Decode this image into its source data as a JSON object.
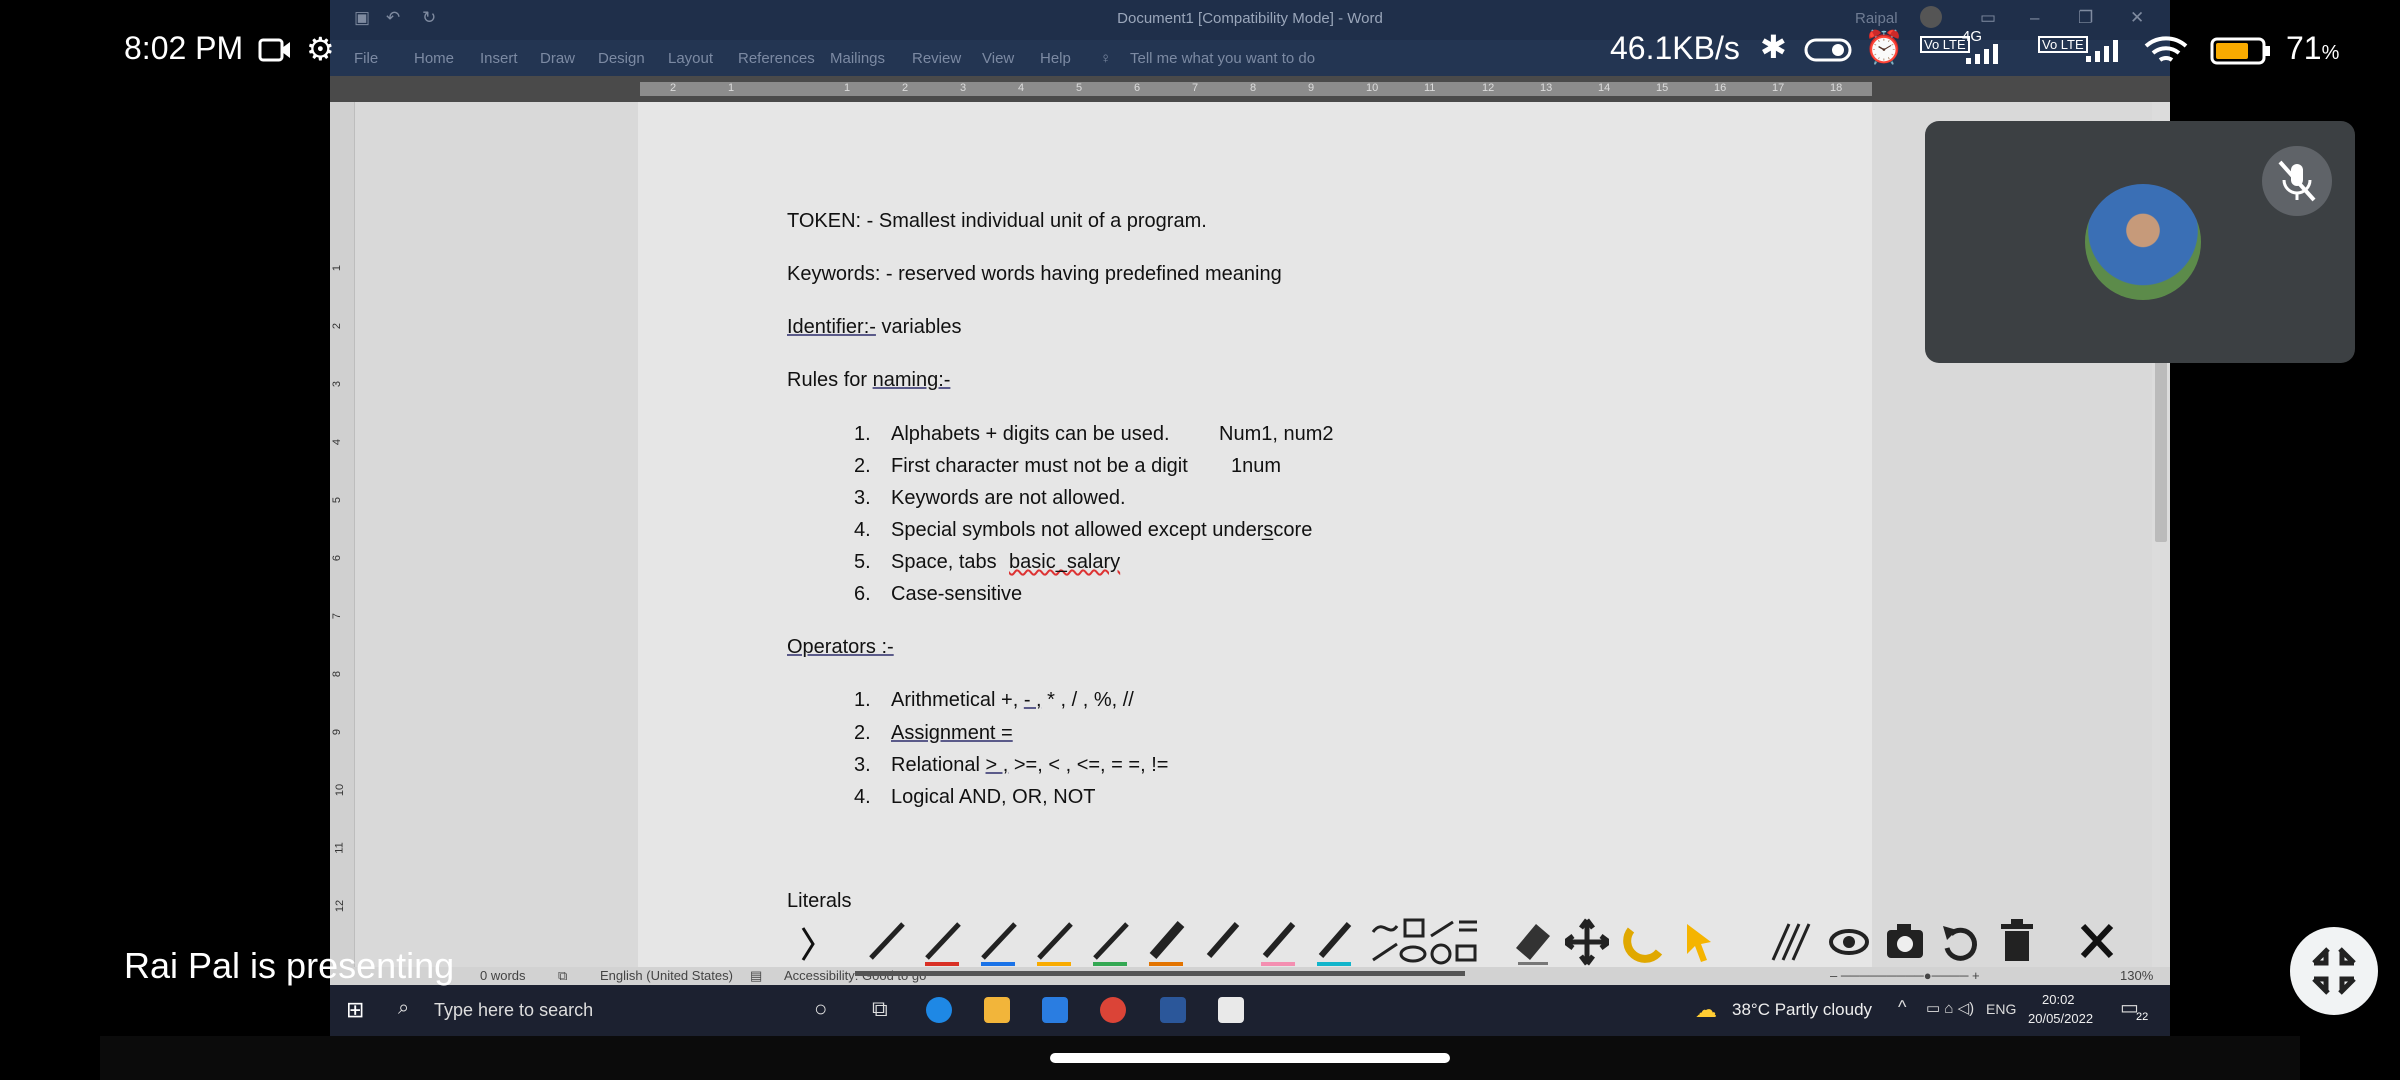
{
  "android_status": {
    "time": "8:02 PM",
    "net_speed": "46.1KB/s",
    "battery_percent": "71",
    "battery_unit": "%",
    "net_gen": "4G",
    "volte": "Vo LTE"
  },
  "word": {
    "window_title": "Document1 [Compatibility Mode] - Word",
    "user_name": "Raipal",
    "ribbon_tabs": [
      "File",
      "Home",
      "Insert",
      "Draw",
      "Design",
      "Layout",
      "References",
      "Mailings",
      "Review",
      "View",
      "Help"
    ],
    "tell_me": "Tell me what you want to do",
    "ruler_numbers": [
      "2",
      "1",
      "1",
      "2",
      "3",
      "4",
      "5",
      "6",
      "7",
      "8",
      "9",
      "10",
      "11",
      "12",
      "13",
      "14",
      "15",
      "16",
      "17",
      "18"
    ],
    "vruler_numbers": [
      "1",
      "2",
      "3",
      "4",
      "5",
      "6",
      "7",
      "8",
      "9",
      "10",
      "11",
      "12"
    ],
    "document": {
      "line_token": "TOKEN: - Smallest individual unit of a program.",
      "line_keywords": "Keywords: - reserved words having predefined meaning",
      "identifier_label": "Identifier:-",
      "identifier_rest": " variables",
      "rules_prefix": "Rules for ",
      "rules_underlined": "naming:-",
      "rules": [
        {
          "num": "1.",
          "text": "Alphabets + digits can be used.",
          "example": "Num1, num2"
        },
        {
          "num": "2.",
          "text": "First character must not be a digit",
          "example": "1num"
        },
        {
          "num": "3.",
          "text": "Keywords are not allowed.",
          "example": ""
        },
        {
          "num": "4.",
          "text": "Special symbols not allowed except underscore",
          "example": "_"
        },
        {
          "num": "5.",
          "text": "Space, tabs",
          "example": "basic_salary"
        },
        {
          "num": "6.",
          "text": "Case-sensitive",
          "example": ""
        }
      ],
      "operators_heading": "Operators :-",
      "operators": [
        {
          "num": "1.",
          "pre": "Arithmetical +, ",
          "ul": "- ,",
          "post": " * , / , %, //"
        },
        {
          "num": "2.",
          "pre": "",
          "ul": "Assignment  =",
          "post": ""
        },
        {
          "num": "3.",
          "pre": "Relational ",
          "ul": "> ,",
          "post": " >=, < , <=, = =, !="
        },
        {
          "num": "4.",
          "pre": "Logical AND, OR, NOT",
          "ul": "",
          "post": ""
        }
      ],
      "literals": "Literals"
    },
    "status": {
      "words": "0 words",
      "language": "English (United States)",
      "accessibility": "Accessibility: Good to go",
      "zoom": "130%"
    },
    "taskbar": {
      "search_placeholder": "Type here to search",
      "weather": "38°C  Partly cloudy",
      "lang": "ENG",
      "clock_time": "20:02",
      "clock_date": "20/05/2022",
      "notif_count": "22"
    }
  },
  "annotation_toolbar": {
    "pen_colors": [
      "#1a1a1a",
      "#d93025",
      "#1a73e8",
      "#f9ab00",
      "#34a853",
      "#e37400",
      "#1a1a1a",
      "#1a1a1a",
      "#12b5cb"
    ]
  },
  "meet": {
    "presenting_text": "Rai Pal is presenting"
  }
}
